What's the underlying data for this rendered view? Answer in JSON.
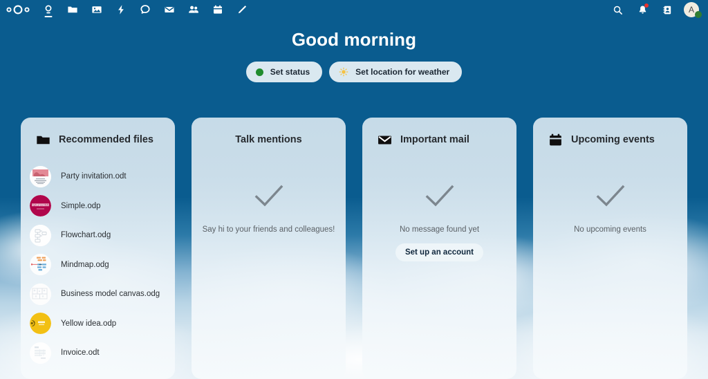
{
  "header": {
    "logo_name": "nextcloud-logo",
    "nav_items": [
      {
        "name": "dashboard",
        "icon": "dashboard-icon",
        "active": true
      },
      {
        "name": "files",
        "icon": "folder-icon",
        "active": false
      },
      {
        "name": "photos",
        "icon": "photos-icon",
        "active": false
      },
      {
        "name": "activity",
        "icon": "lightning-icon",
        "active": false
      },
      {
        "name": "talk",
        "icon": "talk-icon",
        "active": false
      },
      {
        "name": "mail",
        "icon": "mail-icon",
        "active": false
      },
      {
        "name": "contacts",
        "icon": "contacts-icon",
        "active": false
      },
      {
        "name": "calendar",
        "icon": "calendar-icon",
        "active": false
      },
      {
        "name": "notes",
        "icon": "pencil-icon",
        "active": false
      }
    ],
    "right_items": [
      {
        "name": "search",
        "icon": "search-icon"
      },
      {
        "name": "notifications",
        "icon": "bell-icon",
        "badge": true
      },
      {
        "name": "contacts-menu",
        "icon": "contacts-card-icon"
      }
    ],
    "avatar": {
      "initial": "A",
      "status": "online"
    },
    "bar_color": "#0a5c8f"
  },
  "greeting": {
    "title": "Good morning",
    "status_button": "Set status",
    "weather_button": "Set location for weather"
  },
  "cards": [
    {
      "id": "recommended-files",
      "title": "Recommended files",
      "icon": "folder-icon",
      "icon_centered": false,
      "type": "file-list",
      "files": [
        {
          "name": "Party invitation.odt",
          "thumb": "party-invitation-thumb"
        },
        {
          "name": "Simple.odp",
          "thumb": "simple-presentation-thumb"
        },
        {
          "name": "Flowchart.odg",
          "thumb": "flowchart-thumb"
        },
        {
          "name": "Mindmap.odg",
          "thumb": "mindmap-thumb"
        },
        {
          "name": "Business model canvas.odg",
          "thumb": "business-canvas-thumb"
        },
        {
          "name": "Yellow idea.odp",
          "thumb": "yellow-idea-thumb"
        },
        {
          "name": "Invoice.odt",
          "thumb": "invoice-thumb"
        }
      ]
    },
    {
      "id": "talk-mentions",
      "title": "Talk mentions",
      "icon": null,
      "icon_centered": true,
      "type": "empty",
      "empty_icon": "checkmark-icon",
      "empty_text": "Say hi to your friends and colleagues!",
      "cta": null
    },
    {
      "id": "important-mail",
      "title": "Important mail",
      "icon": "mail-icon",
      "icon_centered": false,
      "type": "empty",
      "empty_icon": "checkmark-icon",
      "empty_text": "No message found yet",
      "cta": "Set up an account"
    },
    {
      "id": "upcoming-events",
      "title": "Upcoming events",
      "icon": "calendar-icon",
      "icon_centered": false,
      "type": "empty",
      "empty_icon": "checkmark-icon",
      "empty_text": "No upcoming events",
      "cta": null
    }
  ],
  "colors": {
    "primary": "#0a5c8f",
    "card_bg": "#cfe0eb",
    "status_online": "#1f8c2e",
    "badge": "#e9322d",
    "text_dark": "#262a2e",
    "text_muted": "#5b6166"
  }
}
